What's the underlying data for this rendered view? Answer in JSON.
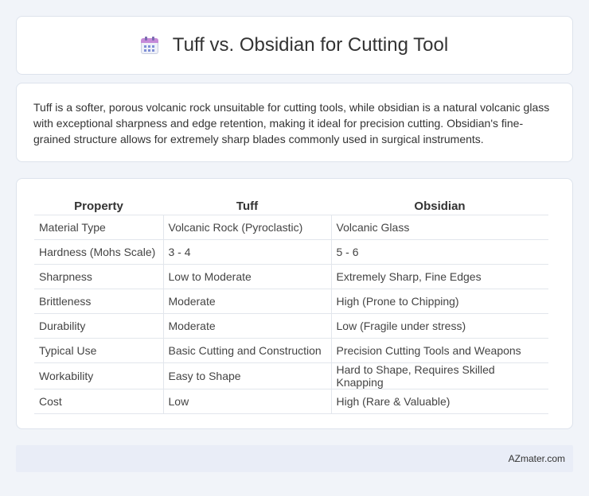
{
  "header": {
    "title": "Tuff vs. Obsidian for Cutting Tool",
    "icon": "calendar-icon"
  },
  "intro": {
    "text": "Tuff is a softer, porous volcanic rock unsuitable for cutting tools, while obsidian is a natural volcanic glass with exceptional sharpness and edge retention, making it ideal for precision cutting. Obsidian's fine-grained structure allows for extremely sharp blades commonly used in surgical instruments."
  },
  "table": {
    "headers": [
      "Property",
      "Tuff",
      "Obsidian"
    ],
    "rows": [
      [
        "Material Type",
        "Volcanic Rock (Pyroclastic)",
        "Volcanic Glass"
      ],
      [
        "Hardness (Mohs Scale)",
        "3 - 4",
        "5 - 6"
      ],
      [
        "Sharpness",
        "Low to Moderate",
        "Extremely Sharp, Fine Edges"
      ],
      [
        "Brittleness",
        "Moderate",
        "High (Prone to Chipping)"
      ],
      [
        "Durability",
        "Moderate",
        "Low (Fragile under stress)"
      ],
      [
        "Typical Use",
        "Basic Cutting and Construction",
        "Precision Cutting Tools and Weapons"
      ],
      [
        "Workability",
        "Easy to Shape",
        "Hard to Shape, Requires Skilled Knapping"
      ],
      [
        "Cost",
        "Low",
        "High (Rare & Valuable)"
      ]
    ]
  },
  "footer": {
    "brand": "AZmater.com"
  }
}
